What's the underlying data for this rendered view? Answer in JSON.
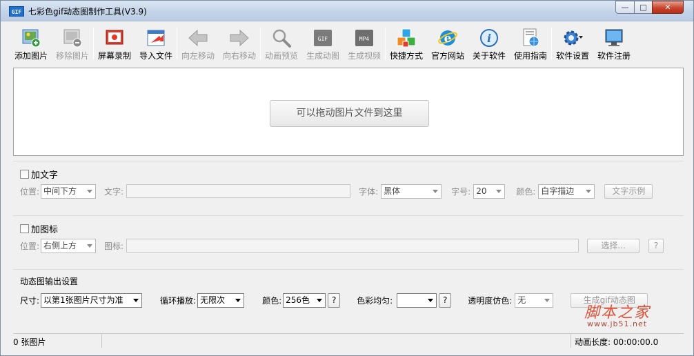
{
  "window": {
    "title": "七彩色gif动态图制作工具(V3.9)",
    "icon_text": "GIF",
    "controls": {
      "minimize": "—",
      "maximize": "□",
      "close": "✕"
    }
  },
  "toolbar": {
    "items": [
      {
        "label": "添加图片",
        "icon": "add-image-icon",
        "enabled": true
      },
      {
        "label": "移除图片",
        "icon": "remove-image-icon",
        "enabled": false
      },
      {
        "label": "屏幕录制",
        "icon": "screen-record-icon",
        "enabled": true
      },
      {
        "label": "导入文件",
        "icon": "import-file-icon",
        "enabled": true
      },
      {
        "label": "向左移动",
        "icon": "arrow-left-icon",
        "enabled": false
      },
      {
        "label": "向右移动",
        "icon": "arrow-right-icon",
        "enabled": false
      },
      {
        "label": "动画预览",
        "icon": "magnifier-icon",
        "enabled": false
      },
      {
        "label": "生成动图",
        "icon": "gif-icon",
        "enabled": false
      },
      {
        "label": "生成视频",
        "icon": "mp4-icon",
        "enabled": false
      },
      {
        "label": "快捷方式",
        "icon": "shortcut-cubes-icon",
        "enabled": true
      },
      {
        "label": "官方网站",
        "icon": "ie-browser-icon",
        "enabled": true
      },
      {
        "label": "关于软件",
        "icon": "info-icon",
        "enabled": true
      },
      {
        "label": "使用指南",
        "icon": "guide-globe-icon",
        "enabled": true
      },
      {
        "label": "软件设置",
        "icon": "gear-icon",
        "enabled": true
      },
      {
        "label": "软件注册",
        "icon": "monitor-icon",
        "enabled": true
      }
    ],
    "icon_text": {
      "gif": "GIF",
      "mp4": "MP4",
      "info": "i",
      "ie": "e"
    }
  },
  "droparea": {
    "button_label": "可以拖动图片文件到这里"
  },
  "text_group": {
    "checkbox_label": "加文字",
    "position_label": "位置:",
    "position_value": "中间下方",
    "text_label": "文字:",
    "text_value": "",
    "font_label": "字体:",
    "font_value": "黑体",
    "size_label": "字号:",
    "size_value": "20",
    "color_label": "颜色:",
    "color_value": "白字描边",
    "sample_button": "文字示例"
  },
  "icon_group": {
    "checkbox_label": "加图标",
    "position_label": "位置:",
    "position_value": "右侧上方",
    "icon_label": "图标:",
    "icon_value": "",
    "choose_button": "选择...",
    "help_button": "?"
  },
  "output_group": {
    "title": "动态图输出设置",
    "size_label": "尺寸:",
    "size_value": "以第1张图片尺寸为准",
    "loop_label": "循环播放:",
    "loop_value": "无限次",
    "color_label": "颜色:",
    "color_value": "256色",
    "color_help": "?",
    "balance_label": "色彩均匀:",
    "balance_value": "",
    "balance_help": "?",
    "dither_label": "透明度仿色:",
    "dither_value": "无",
    "generate_button": "生成gif动态图"
  },
  "statusbar": {
    "count": "0 张图片",
    "duration": "动画长度: 00:00:00.0"
  },
  "watermark": {
    "main": "脚本之家",
    "sub": "www.jb51.net"
  },
  "colors": {
    "accent": "#1e6fd0",
    "close": "#c9452d",
    "watermark": "#e0533a"
  }
}
